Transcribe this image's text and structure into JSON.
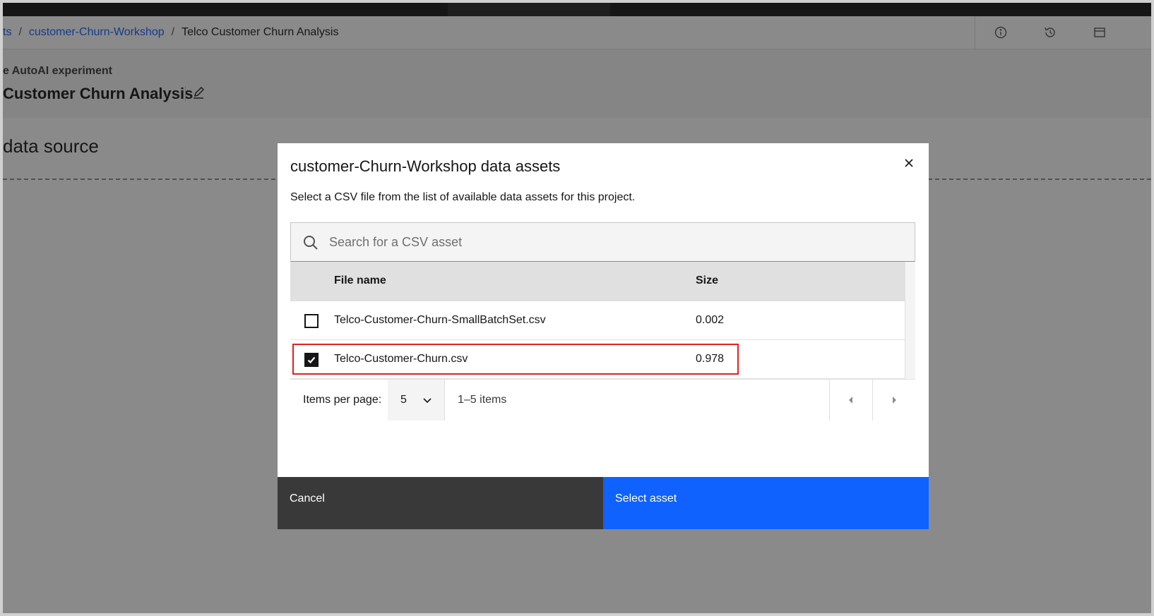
{
  "breadcrumb": {
    "items": [
      "ts",
      "customer-Churn-Workshop"
    ],
    "current": "Telco Customer Churn Analysis",
    "separator": "/"
  },
  "header": {
    "experiment_label": "e AutoAI experiment",
    "experiment_title": "Customer Churn Analysis"
  },
  "section": {
    "title": "data source"
  },
  "modal": {
    "title": "customer-Churn-Workshop data assets",
    "description": "Select a CSV file from the list of available data assets for this project.",
    "search_placeholder": "Search for a CSV asset",
    "columns": {
      "file_name": "File name",
      "size": "Size"
    },
    "rows": [
      {
        "file_name": "Telco-Customer-Churn-SmallBatchSet.csv",
        "size": "0.002",
        "checked": false
      },
      {
        "file_name": "Telco-Customer-Churn.csv",
        "size": "0.978",
        "checked": true
      }
    ],
    "pagination": {
      "items_per_page_label": "Items per page:",
      "items_per_page_value": "5",
      "range_text": "1–5 items"
    },
    "cancel_label": "Cancel",
    "primary_label": "Select asset"
  },
  "colors": {
    "primary": "#0f62fe",
    "secondary_button": "#393939",
    "highlight_box": "#e02020",
    "overlay": "rgba(22,22,22,0.5)"
  }
}
